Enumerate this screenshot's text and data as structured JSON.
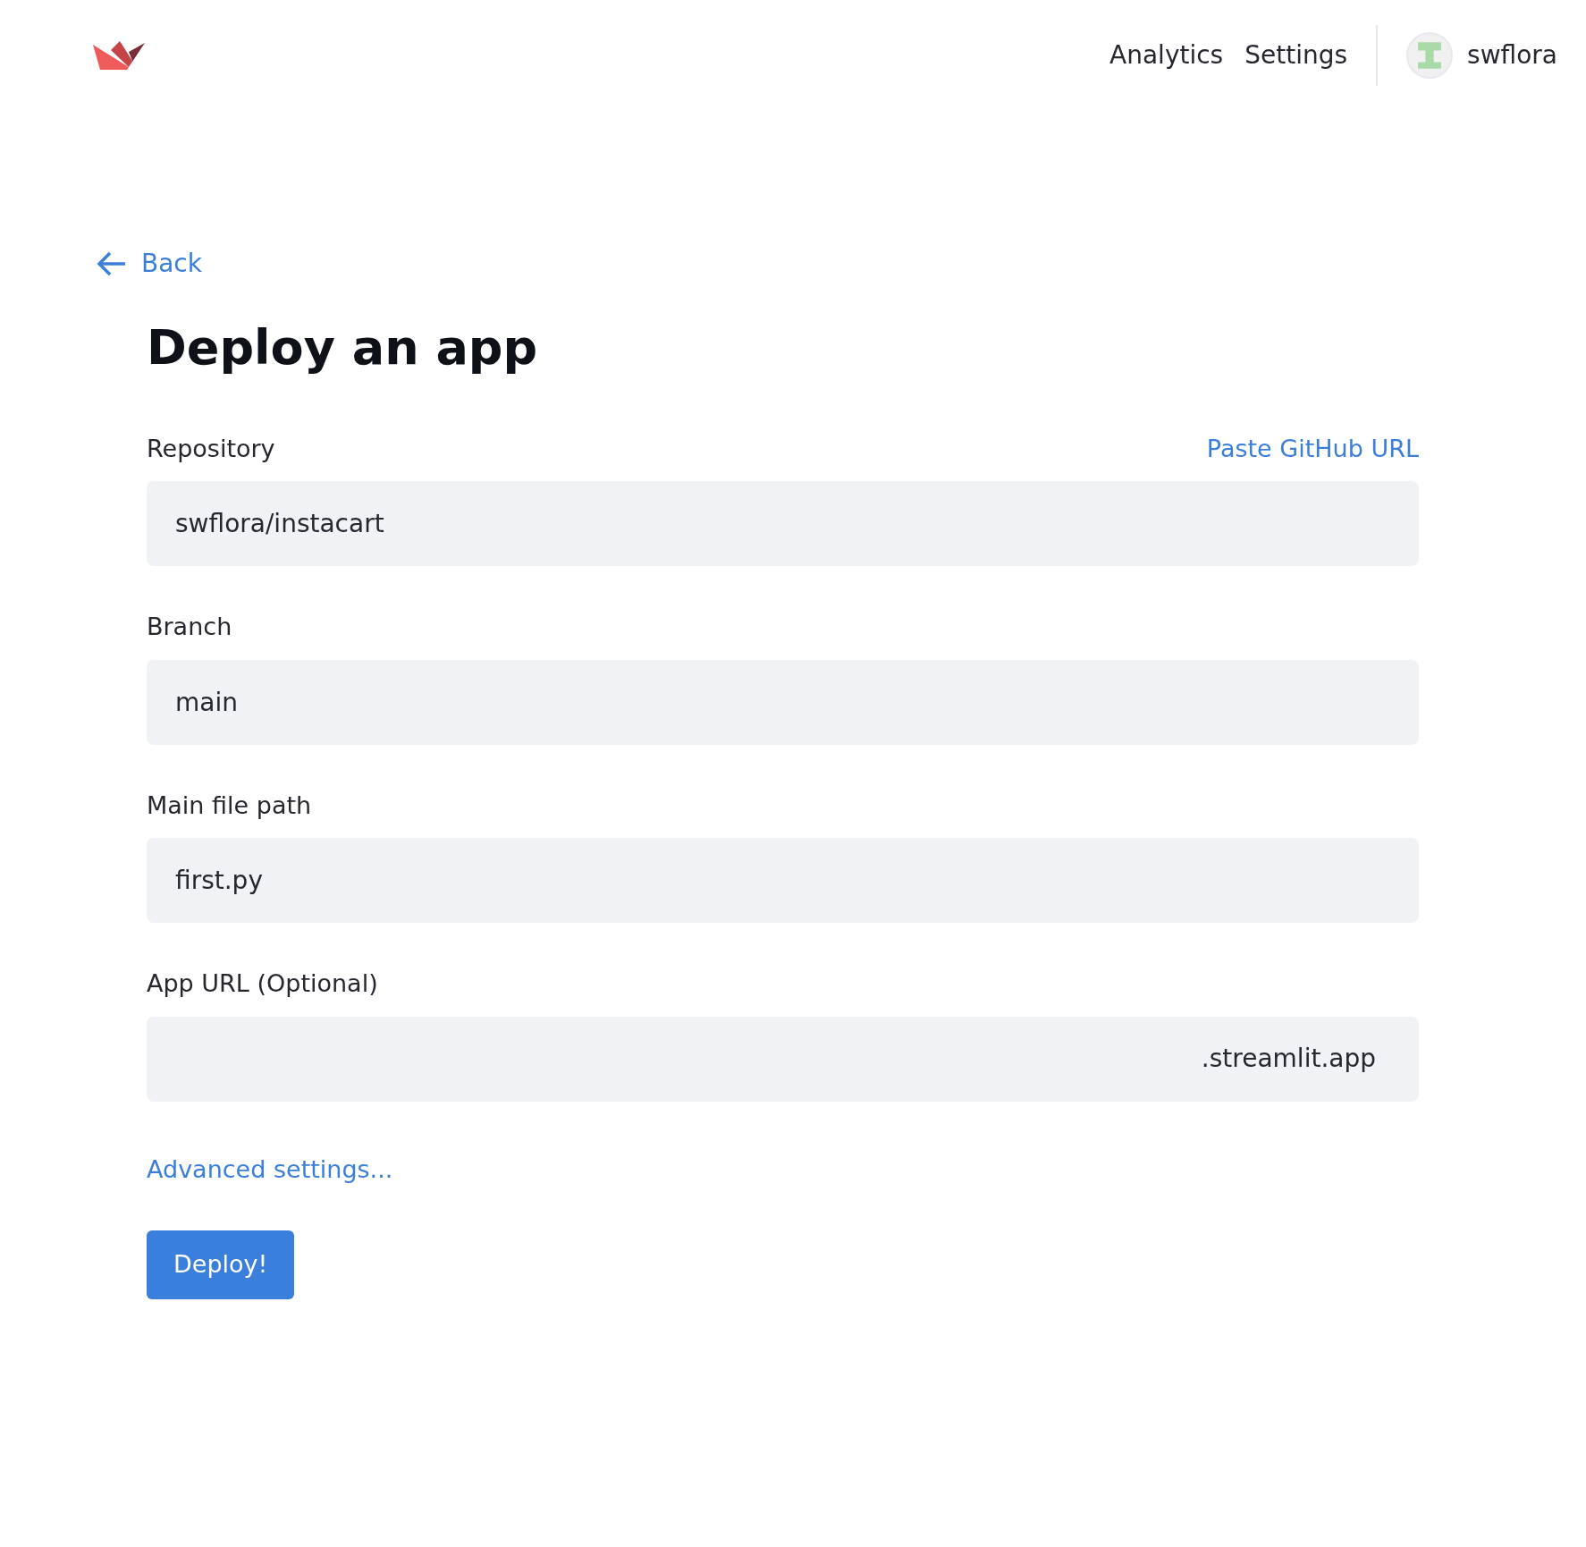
{
  "nav": {
    "links": [
      {
        "label": "Analytics"
      },
      {
        "label": "Settings"
      }
    ],
    "user": "swflora"
  },
  "back": "Back",
  "title": "Deploy an app",
  "fields": [
    {
      "label": "Repository",
      "value": "swflora/instacart",
      "action": "Paste GitHub URL"
    },
    {
      "label": "Branch",
      "value": "main"
    },
    {
      "label": "Main file path",
      "value": "first.py"
    },
    {
      "label": "App URL (Optional)",
      "suffix": ".streamlit.app"
    }
  ],
  "advanced": "Advanced settings...",
  "submit": "Deploy!"
}
